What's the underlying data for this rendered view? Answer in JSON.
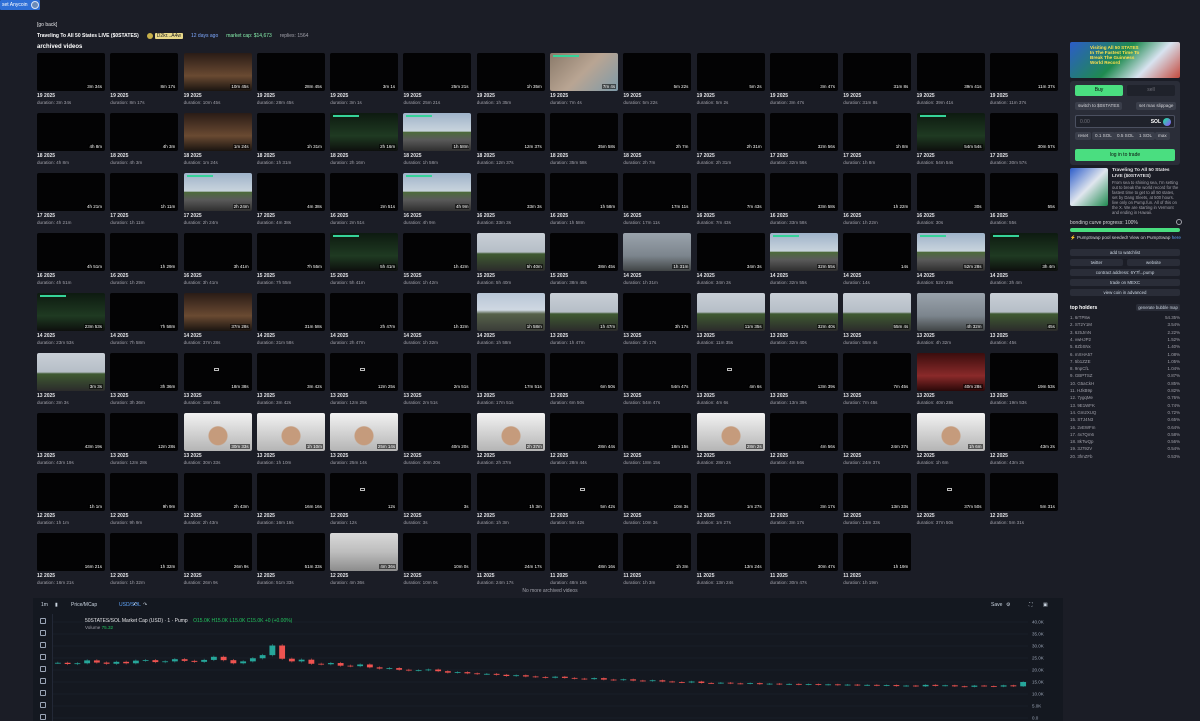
{
  "top_badge": "set Anycoin",
  "go_back": "[go back]",
  "coin_info": {
    "title": "Traveling To All 50 States LIVE ($0STATES)",
    "creator": "D2kr...A4w",
    "ago": "12 days ago",
    "market_cap": "market cap: $14,673",
    "replies": "replies: 1564"
  },
  "archived_title": "archived videos",
  "videos": [
    {
      "d": "19 2025",
      "len": "3m 34s",
      "dur": "duration: 3m 34s",
      "t": ""
    },
    {
      "d": "19 2025",
      "len": "8m 17s",
      "dur": "duration: 8m 17s",
      "t": ""
    },
    {
      "d": "19 2025",
      "len": "10m 45s",
      "dur": "duration: 10m 45s",
      "t": "dim"
    },
    {
      "d": "19 2025",
      "len": "28m 45s",
      "dur": "duration: 28m 45s",
      "t": ""
    },
    {
      "d": "19 2025",
      "len": "3m 1s",
      "dur": "duration: 3m 1s",
      "t": ""
    },
    {
      "d": "19 2025",
      "len": "25m 21s",
      "dur": "duration: 25m 21s",
      "t": ""
    },
    {
      "d": "19 2025",
      "len": "1h 35m",
      "dur": "duration: 1h 35m",
      "t": ""
    },
    {
      "d": "19 2025",
      "len": "7m 4s",
      "dur": "duration: 7m 4s",
      "t": "hand"
    },
    {
      "d": "19 2025",
      "len": "5m 22s",
      "dur": "duration: 5m 22s",
      "t": ""
    },
    {
      "d": "19 2025",
      "len": "5m 2s",
      "dur": "duration: 5m 2s",
      "t": ""
    },
    {
      "d": "19 2025",
      "len": "3m 47s",
      "dur": "duration: 3m 47s",
      "t": ""
    },
    {
      "d": "19 2025",
      "len": "31m 8s",
      "dur": "duration: 31m 8s",
      "t": ""
    },
    {
      "d": "19 2025",
      "len": "39m 41s",
      "dur": "duration: 39m 41s",
      "t": ""
    },
    {
      "d": "19 2025",
      "len": "11m 37s",
      "dur": "duration: 11m 37s",
      "t": ""
    },
    {
      "d": "18 2025",
      "len": "4h 8m",
      "dur": "duration: 4h 8m",
      "t": ""
    },
    {
      "d": "18 2025",
      "len": "4h 3m",
      "dur": "duration: 4h 3m",
      "t": ""
    },
    {
      "d": "18 2025",
      "len": "1m 24s",
      "dur": "duration: 1m 24s",
      "t": "dim"
    },
    {
      "d": "18 2025",
      "len": "1h 31m",
      "dur": "duration: 1h 31m",
      "t": ""
    },
    {
      "d": "18 2025",
      "len": "2h 16m",
      "dur": "duration: 2h 16m",
      "t": "dash"
    },
    {
      "d": "18 2025",
      "len": "1h 58m",
      "dur": "duration: 1h 58m",
      "t": "road"
    },
    {
      "d": "18 2025",
      "len": "12m 37s",
      "dur": "duration: 12m 37s",
      "t": ""
    },
    {
      "d": "18 2025",
      "len": "35m 58s",
      "dur": "duration: 35m 58s",
      "t": ""
    },
    {
      "d": "18 2025",
      "len": "2h 7m",
      "dur": "duration: 2h 7m",
      "t": ""
    },
    {
      "d": "17 2025",
      "len": "2h 31m",
      "dur": "duration: 2h 31m",
      "t": ""
    },
    {
      "d": "17 2025",
      "len": "32m 56s",
      "dur": "duration: 32m 56s",
      "t": ""
    },
    {
      "d": "17 2025",
      "len": "1h 8m",
      "dur": "duration: 1h 8m",
      "t": ""
    },
    {
      "d": "17 2025",
      "len": "54m 54s",
      "dur": "duration: 54m 54s",
      "t": "dash"
    },
    {
      "d": "17 2025",
      "len": "30m 57s",
      "dur": "duration: 30m 57s",
      "t": ""
    },
    {
      "d": "17 2025",
      "len": "4h 21m",
      "dur": "duration: 4h 21m",
      "t": ""
    },
    {
      "d": "17 2025",
      "len": "1h 11m",
      "dur": "duration: 1h 11m",
      "t": ""
    },
    {
      "d": "17 2025",
      "len": "2h 24m",
      "dur": "duration: 2h 24m",
      "t": "road"
    },
    {
      "d": "17 2025",
      "len": "4m 38s",
      "dur": "duration: 4m 38s",
      "t": ""
    },
    {
      "d": "16 2025",
      "len": "2m 51s",
      "dur": "duration: 2m 51s",
      "t": ""
    },
    {
      "d": "16 2025",
      "len": "4h 9m",
      "dur": "duration: 4h 9m",
      "t": "road"
    },
    {
      "d": "16 2025",
      "len": "33m 3s",
      "dur": "duration: 33m 3s",
      "t": ""
    },
    {
      "d": "16 2025",
      "len": "1h 58m",
      "dur": "duration: 1h 58m",
      "t": ""
    },
    {
      "d": "16 2025",
      "len": "17m 11s",
      "dur": "duration: 17m 11s",
      "t": ""
    },
    {
      "d": "16 2025",
      "len": "7m 43s",
      "dur": "duration: 7m 43s",
      "t": ""
    },
    {
      "d": "16 2025",
      "len": "33m 58s",
      "dur": "duration: 33m 58s",
      "t": ""
    },
    {
      "d": "16 2025",
      "len": "1h 22m",
      "dur": "duration: 1h 22m",
      "t": ""
    },
    {
      "d": "16 2025",
      "len": "30s",
      "dur": "duration: 30s",
      "t": ""
    },
    {
      "d": "16 2025",
      "len": "55s",
      "dur": "duration: 55s",
      "t": ""
    },
    {
      "d": "16 2025",
      "len": "4h 51m",
      "dur": "duration: 4h 51m",
      "t": ""
    },
    {
      "d": "16 2025",
      "len": "1h 29m",
      "dur": "duration: 1h 29m",
      "t": ""
    },
    {
      "d": "16 2025",
      "len": "3h 41m",
      "dur": "duration: 3h 41m",
      "t": ""
    },
    {
      "d": "15 2025",
      "len": "7h 55m",
      "dur": "duration: 7h 55m",
      "t": ""
    },
    {
      "d": "15 2025",
      "len": "5h 41m",
      "dur": "duration: 5h 41m",
      "t": "dash"
    },
    {
      "d": "15 2025",
      "len": "1h 42m",
      "dur": "duration: 1h 42m",
      "t": ""
    },
    {
      "d": "15 2025",
      "len": "5h 40m",
      "dur": "duration: 5h 40m",
      "t": "trees"
    },
    {
      "d": "15 2025",
      "len": "38m 45s",
      "dur": "duration: 38m 45s",
      "t": ""
    },
    {
      "d": "14 2025",
      "len": "1h 31m",
      "dur": "duration: 1h 31m",
      "t": "rain"
    },
    {
      "d": "14 2025",
      "len": "34m 3s",
      "dur": "duration: 34m 3s",
      "t": ""
    },
    {
      "d": "14 2025",
      "len": "32m 55s",
      "dur": "duration: 32m 55s",
      "t": "road"
    },
    {
      "d": "14 2025",
      "len": "14s",
      "dur": "duration: 14s",
      "t": ""
    },
    {
      "d": "14 2025",
      "len": "52m 28s",
      "dur": "duration: 52m 28s",
      "t": "road"
    },
    {
      "d": "14 2025",
      "len": "3h 4m",
      "dur": "duration: 3h 4m",
      "t": "dash"
    },
    {
      "d": "14 2025",
      "len": "23m 53s",
      "dur": "duration: 23m 53s",
      "t": "dash"
    },
    {
      "d": "14 2025",
      "len": "7h 58m",
      "dur": "duration: 7h 58m",
      "t": ""
    },
    {
      "d": "14 2025",
      "len": "37m 28s",
      "dur": "duration: 37m 28s",
      "t": "dim"
    },
    {
      "d": "14 2025",
      "len": "31m 58s",
      "dur": "duration: 31m 58s",
      "t": ""
    },
    {
      "d": "14 2025",
      "len": "2h 47m",
      "dur": "duration: 2h 47m",
      "t": ""
    },
    {
      "d": "14 2025",
      "len": "1h 32m",
      "dur": "duration: 1h 32m",
      "t": ""
    },
    {
      "d": "14 2025",
      "len": "1h 58m",
      "dur": "duration: 1h 58m",
      "t": "sky"
    },
    {
      "d": "13 2025",
      "len": "1h 47m",
      "dur": "duration: 1h 47m",
      "t": "trees"
    },
    {
      "d": "13 2025",
      "len": "3h 17s",
      "dur": "duration: 3h 17s",
      "t": ""
    },
    {
      "d": "13 2025",
      "len": "11m 35s",
      "dur": "duration: 11m 35s",
      "t": "trees"
    },
    {
      "d": "13 2025",
      "len": "32m 40s",
      "dur": "duration: 32m 40s",
      "t": "trees"
    },
    {
      "d": "13 2025",
      "len": "55m 4s",
      "dur": "duration: 55m 4s",
      "t": "trees"
    },
    {
      "d": "13 2025",
      "len": "4h 32m",
      "dur": "duration: 4h 32m",
      "t": "rain"
    },
    {
      "d": "13 2025",
      "len": "45s",
      "dur": "duration: 45s",
      "t": "trees"
    },
    {
      "d": "13 2025",
      "len": "3m 3s",
      "dur": "duration: 3m 3s",
      "t": "trees"
    },
    {
      "d": "13 2025",
      "len": "3h 36m",
      "dur": "duration: 3h 36m",
      "t": ""
    },
    {
      "d": "13 2025",
      "len": "18m 38s",
      "dur": "duration: 18m 38s",
      "t": "cam"
    },
    {
      "d": "13 2025",
      "len": "3m 42s",
      "dur": "duration: 3m 42s",
      "t": ""
    },
    {
      "d": "13 2025",
      "len": "12m 25s",
      "dur": "duration: 12m 25s",
      "t": "cam"
    },
    {
      "d": "13 2025",
      "len": "2m 51s",
      "dur": "duration: 2m 51s",
      "t": ""
    },
    {
      "d": "13 2025",
      "len": "17m 51s",
      "dur": "duration: 17m 51s",
      "t": ""
    },
    {
      "d": "13 2025",
      "len": "6m 50s",
      "dur": "duration: 6m 50s",
      "t": ""
    },
    {
      "d": "13 2025",
      "len": "54m 47s",
      "dur": "duration: 54m 47s",
      "t": ""
    },
    {
      "d": "13 2025",
      "len": "4m 6s",
      "dur": "duration: 4m 6s",
      "t": "cam"
    },
    {
      "d": "13 2025",
      "len": "13m 39s",
      "dur": "duration: 13m 39s",
      "t": ""
    },
    {
      "d": "13 2025",
      "len": "7m 45s",
      "dur": "duration: 7m 45s",
      "t": ""
    },
    {
      "d": "13 2025",
      "len": "40m 28s",
      "dur": "duration: 40m 28s",
      "t": "red"
    },
    {
      "d": "13 2025",
      "len": "19m 53s",
      "dur": "duration: 19m 53s",
      "t": ""
    },
    {
      "d": "13 2025",
      "len": "43m 19s",
      "dur": "duration: 43m 19s",
      "t": ""
    },
    {
      "d": "13 2025",
      "len": "12m 28s",
      "dur": "duration: 12m 28s",
      "t": ""
    },
    {
      "d": "13 2025",
      "len": "30m 33s",
      "dur": "duration: 30m 33s",
      "t": "face"
    },
    {
      "d": "13 2025",
      "len": "1h 10m",
      "dur": "duration: 1h 10m",
      "t": "face"
    },
    {
      "d": "13 2025",
      "len": "25m 14s",
      "dur": "duration: 25m 14s",
      "t": "face"
    },
    {
      "d": "12 2025",
      "len": "40m 20s",
      "dur": "duration: 40m 20s",
      "t": ""
    },
    {
      "d": "12 2025",
      "len": "2h 37m",
      "dur": "duration: 2h 37m",
      "t": "face"
    },
    {
      "d": "12 2025",
      "len": "28m 44s",
      "dur": "duration: 28m 44s",
      "t": ""
    },
    {
      "d": "12 2025",
      "len": "18m 15s",
      "dur": "duration: 18m 15s",
      "t": ""
    },
    {
      "d": "12 2025",
      "len": "28m 2s",
      "dur": "duration: 28m 2s",
      "t": "face"
    },
    {
      "d": "12 2025",
      "len": "4m 56s",
      "dur": "duration: 4m 56s",
      "t": ""
    },
    {
      "d": "12 2025",
      "len": "24m 37s",
      "dur": "duration: 24m 37s",
      "t": ""
    },
    {
      "d": "12 2025",
      "len": "1h 6m",
      "dur": "duration: 1h 6m",
      "t": "face"
    },
    {
      "d": "12 2025",
      "len": "43m 2s",
      "dur": "duration: 43m 2s",
      "t": ""
    },
    {
      "d": "12 2025",
      "len": "1h 1m",
      "dur": "duration: 1h 1m",
      "t": ""
    },
    {
      "d": "12 2025",
      "len": "9h 9m",
      "dur": "duration: 9h 9m",
      "t": ""
    },
    {
      "d": "12 2025",
      "len": "2h 43m",
      "dur": "duration: 2h 43m",
      "t": ""
    },
    {
      "d": "12 2025",
      "len": "16m 16s",
      "dur": "duration: 16m 16s",
      "t": ""
    },
    {
      "d": "12 2025",
      "len": "12s",
      "dur": "duration: 12s",
      "t": "cam"
    },
    {
      "d": "12 2025",
      "len": "3s",
      "dur": "duration: 3s",
      "t": ""
    },
    {
      "d": "12 2025",
      "len": "1h 3m",
      "dur": "duration: 1h 3m",
      "t": ""
    },
    {
      "d": "12 2025",
      "len": "5m 42s",
      "dur": "duration: 5m 42s",
      "t": "cam"
    },
    {
      "d": "12 2025",
      "len": "10m 3s",
      "dur": "duration: 10m 3s",
      "t": ""
    },
    {
      "d": "12 2025",
      "len": "1m 27s",
      "dur": "duration: 1m 27s",
      "t": ""
    },
    {
      "d": "12 2025",
      "len": "3m 17s",
      "dur": "duration: 3m 17s",
      "t": ""
    },
    {
      "d": "12 2025",
      "len": "13m 33s",
      "dur": "duration: 13m 33s",
      "t": ""
    },
    {
      "d": "12 2025",
      "len": "37m 50s",
      "dur": "duration: 37m 50s",
      "t": "cam"
    },
    {
      "d": "12 2025",
      "len": "5m 31s",
      "dur": "duration: 5m 31s",
      "t": ""
    },
    {
      "d": "12 2025",
      "len": "16m 21s",
      "dur": "duration: 16m 21s",
      "t": ""
    },
    {
      "d": "12 2025",
      "len": "1h 32m",
      "dur": "duration: 1h 32m",
      "t": ""
    },
    {
      "d": "12 2025",
      "len": "26m 9s",
      "dur": "duration: 26m 9s",
      "t": ""
    },
    {
      "d": "12 2025",
      "len": "51m 33s",
      "dur": "duration: 51m 33s",
      "t": ""
    },
    {
      "d": "12 2025",
      "len": "4m 36s",
      "dur": "duration: 4m 36s",
      "t": "room"
    },
    {
      "d": "12 2025",
      "len": "10m 0s",
      "dur": "duration: 10m 0s",
      "t": ""
    },
    {
      "d": "11 2025",
      "len": "24m 17s",
      "dur": "duration: 24m 17s",
      "t": ""
    },
    {
      "d": "11 2025",
      "len": "48m 16s",
      "dur": "duration: 48m 16s",
      "t": ""
    },
    {
      "d": "11 2025",
      "len": "1h 3m",
      "dur": "duration: 1h 3m",
      "t": ""
    },
    {
      "d": "11 2025",
      "len": "13m 24s",
      "dur": "duration: 13m 24s",
      "t": ""
    },
    {
      "d": "11 2025",
      "len": "30m 47s",
      "dur": "duration: 30m 47s",
      "t": ""
    },
    {
      "d": "11 2025",
      "len": "1h 19m",
      "dur": "duration: 1h 19m",
      "t": ""
    }
  ],
  "no_more": "No more archived videos",
  "chart_toolbar": {
    "interval": "1m",
    "price_mcap": "Price/MCap",
    "usd_sol": "USD/SOL",
    "save": "Save"
  },
  "chart_legend": {
    "pair": "50STATES/SOL Market Cap (USD) · 1 · Pump",
    "ohlc": "O15.0K H15.0K L15.0K C15.0K +0 (+0.00%)",
    "volume_label": "Volume",
    "volume_value": "75.32"
  },
  "chart_data": {
    "type": "line",
    "y_ticks": [
      "40.0K",
      "35.0K",
      "30.0K",
      "25.0K",
      "20.0K",
      "15.0K",
      "10.0K",
      "5.0K",
      "0.0"
    ],
    "ylim": [
      0,
      40000
    ],
    "values": [
      23000,
      22500,
      22800,
      24000,
      23100,
      22600,
      23400,
      22800,
      23900,
      24100,
      23300,
      23600,
      24500,
      23800,
      23400,
      24200,
      25500,
      24100,
      22800,
      23600,
      24900,
      26200,
      30200,
      24700,
      23600,
      24300,
      22600,
      22400,
      22900,
      21800,
      21600,
      22300,
      21100,
      20600,
      20800,
      20100,
      19800,
      19900,
      20200,
      19500,
      18900,
      19100,
      18600,
      18300,
      18400,
      18000,
      17500,
      17800,
      17300,
      17100,
      16800,
      17200,
      16700,
      16400,
      16200,
      16600,
      16000,
      15800,
      16100,
      15600,
      15400,
      15700,
      15200,
      15000,
      14800,
      15200,
      14600,
      14500,
      14700,
      14400,
      14300,
      14500,
      14100,
      14300,
      14000,
      14200,
      13900,
      14100,
      13800,
      14000,
      13700,
      13900,
      13600,
      13800,
      13500,
      13700,
      13300,
      13500,
      13200,
      13800,
      13400,
      13600,
      13200,
      13000,
      13500,
      13300,
      13100,
      13600,
      13200,
      15000
    ]
  },
  "right_panel": {
    "banner_text": "Visiting All 50 STATES In The Fastest Time To Break The Guinness World Record",
    "buy": "Buy",
    "sell": "sell",
    "switch": "switch to $0STATES",
    "slippage": "set max slippage",
    "amount_placeholder": "0.00",
    "sol": "SOL",
    "presets": [
      "reset",
      "0.1 SOL",
      "0.5 SOL",
      "1 SOL",
      "max"
    ],
    "login": "log in to trade",
    "coin_title": "Traveling To All 50 States LIVE ($0STATES)",
    "coin_desc": "From sea to shining sea, I'm setting out to break the world record for the fastest time to get to all 50 states, set by Dang Sleets, at 500 hours. live only on Pump.fun. All of this on the X. We are starting in Vermont and ending in Hawaii.",
    "bonding": "bonding curve progress: 100%",
    "pumpswap": "PumpSwap pool seeded! View on PumpSwap",
    "pumpswap_here": "here",
    "add_watchlist": "add to watchlist",
    "twitter": "twitter",
    "website": "website",
    "contract": "contract address: 6Y7f...pump",
    "trade_mexc": "trade on MEXC",
    "view_advanced": "view coin in advanced",
    "holders_title": "top holders",
    "bubble_map": "generate bubble map",
    "holders": [
      {
        "n": "1. 6rTP8w",
        "p": "54.35%"
      },
      {
        "n": "2. ST2Y1M",
        "p": "3.54%"
      },
      {
        "n": "3. 6z5JmN",
        "p": "2.22%"
      },
      {
        "n": "4. vwHJP2",
        "p": "1.52%"
      },
      {
        "n": "5. 8ZbSNx",
        "p": "1.40%"
      },
      {
        "n": "6. mXHA57",
        "p": "1.08%"
      },
      {
        "n": "7. 5b1ZZE",
        "p": "1.05%"
      },
      {
        "n": "8. 9npCfL",
        "p": "1.04%"
      },
      {
        "n": "9. GBPTSZ",
        "p": "0.87%"
      },
      {
        "n": "10. G5aCkH",
        "p": "0.85%"
      },
      {
        "n": "11. HJkB9p",
        "p": "0.82%"
      },
      {
        "n": "12. 7ygqMe",
        "p": "0.76%"
      },
      {
        "n": "13. 9E1WFK",
        "p": "0.74%"
      },
      {
        "n": "14. Gm2XUQ",
        "p": "0.72%"
      },
      {
        "n": "15. STJ4N3",
        "p": "0.65%"
      },
      {
        "n": "16. 2vEWFm",
        "p": "0.64%"
      },
      {
        "n": "17. 4x7Qm6",
        "p": "0.58%"
      },
      {
        "n": "18. 8kTwQp",
        "p": "0.56%"
      },
      {
        "n": "19. 3J792V",
        "p": "0.54%"
      },
      {
        "n": "20. 3fmZFb",
        "p": "0.53%"
      }
    ]
  }
}
